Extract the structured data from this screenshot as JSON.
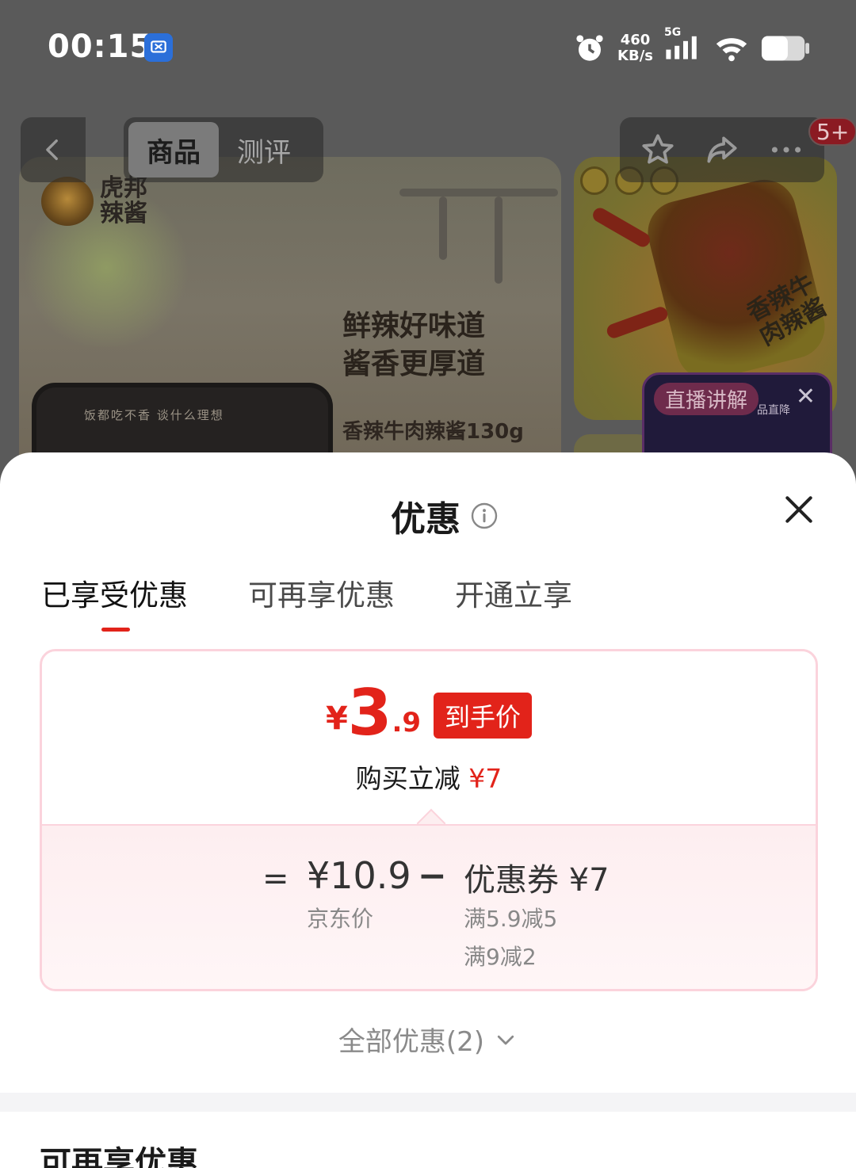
{
  "status_bar": {
    "time": "00:15",
    "speed_value": "460",
    "speed_unit": "KB/s",
    "network": "5G"
  },
  "nav": {
    "tabs": [
      "商品",
      "测评"
    ],
    "cart_badge": "5+"
  },
  "background": {
    "brand_name": "虎邦辣酱",
    "slogan_line1": "鲜辣好味道",
    "slogan_line2": "酱香更厚道",
    "product_name": "香辣牛肉辣酱130g",
    "jar_label": "饭都吃不香  谈什么理想",
    "side_tag": "香辣牛肉辣酱",
    "live_label": "直播讲解",
    "live_sub": "品直降"
  },
  "sheet": {
    "title": "优惠",
    "tabs": [
      "已享受优惠",
      "可再享优惠",
      "开通立享"
    ],
    "active_tab_index": 0,
    "card": {
      "currency": "¥",
      "final_int": "3",
      "final_dec": ".9",
      "final_tag": "到手价",
      "reduce_text": "购买立减",
      "reduce_amount": "¥7",
      "equals": "=",
      "jd_price": "¥10.9",
      "jd_label": "京东价",
      "minus": "−",
      "coupon": "优惠券 ¥7",
      "rule1": "满5.9减5",
      "rule2": "满9减2"
    },
    "all_offers": "全部优惠(2)",
    "next_section_title": "可再享优惠"
  },
  "colors": {
    "accent": "#e2231a",
    "card_border": "#fbd3dc",
    "card_tint": "#fdeef0"
  }
}
